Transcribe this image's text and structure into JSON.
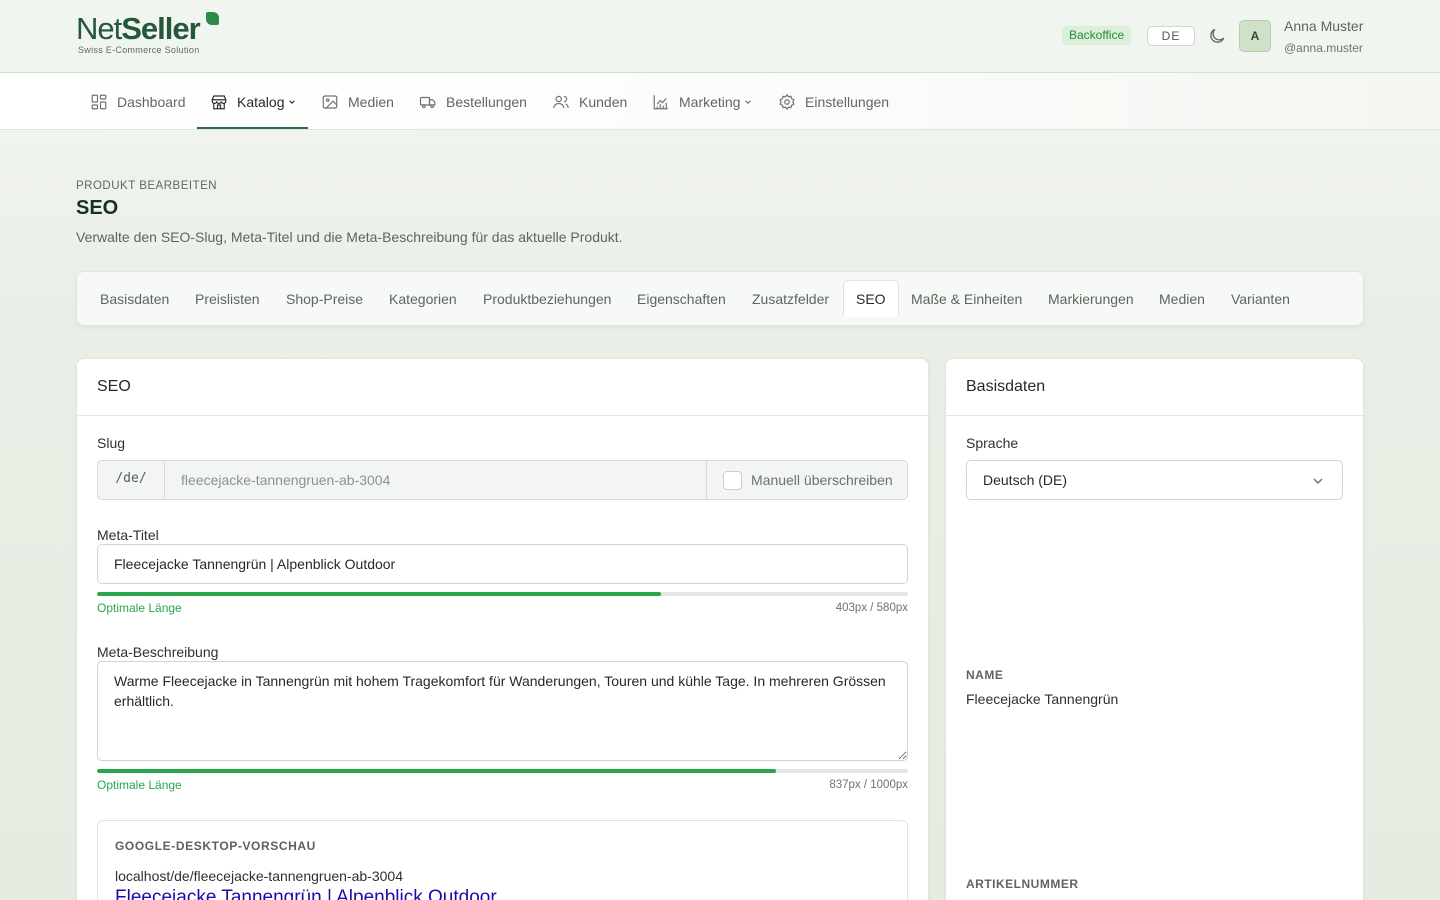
{
  "brand": {
    "logo_net": "Net",
    "logo_seller": "Seller",
    "tagline": "Swiss E-Commerce Solution"
  },
  "header": {
    "badge": "Backoffice",
    "language": "DE",
    "avatar_initial": "A",
    "user_name": "Anna Muster",
    "user_handle": "@anna.muster",
    "theme_icon": "moon-icon"
  },
  "nav": {
    "items": [
      {
        "label": "Dashboard",
        "icon": "dashboard-icon"
      },
      {
        "label": "Katalog",
        "icon": "store-icon",
        "active": true,
        "dropdown": true
      },
      {
        "label": "Medien",
        "icon": "image-icon"
      },
      {
        "label": "Bestellungen",
        "icon": "truck-icon"
      },
      {
        "label": "Kunden",
        "icon": "users-icon"
      },
      {
        "label": "Marketing",
        "icon": "chart-icon",
        "dropdown": true
      },
      {
        "label": "Einstellungen",
        "icon": "gear-icon"
      }
    ]
  },
  "page": {
    "eyebrow": "PRODUKT BEARBEITEN",
    "title": "SEO",
    "description": "Verwalte den SEO-Slug, Meta-Titel und die Meta-Beschreibung für das aktuelle Produkt."
  },
  "tabs": [
    {
      "label": "Basisdaten"
    },
    {
      "label": "Preislisten"
    },
    {
      "label": "Shop-Preise"
    },
    {
      "label": "Kategorien"
    },
    {
      "label": "Produktbeziehungen"
    },
    {
      "label": "Eigenschaften"
    },
    {
      "label": "Zusatzfelder"
    },
    {
      "label": "SEO",
      "active": true
    },
    {
      "label": "Maße & Einheiten"
    },
    {
      "label": "Markierungen"
    },
    {
      "label": "Medien"
    },
    {
      "label": "Varianten"
    }
  ],
  "seo": {
    "card_title": "SEO",
    "slug_label": "Slug",
    "slug_prefix": "/de/",
    "slug_value": "fleecejacke-tannengruen-ab-3004",
    "slug_override_label": "Manuell überschreiben",
    "meta_title_label": "Meta-Titel",
    "meta_title_value": "Fleecejacke Tannengrün | Alpenblick Outdoor",
    "meta_title_status": "Optimale Länge",
    "meta_title_length": "403px / 580px",
    "meta_title_ratio": 0.695,
    "meta_desc_label": "Meta-Beschreibung",
    "meta_desc_value": "Warme Fleecejacke in Tannengrün mit hohem Tragekomfort für Wanderungen, Touren und kühle Tage. In mehreren Grössen erhältlich.",
    "meta_desc_status": "Optimale Länge",
    "meta_desc_length": "837px / 1000px",
    "meta_desc_ratio": 0.837,
    "preview_label": "GOOGLE-DESKTOP-VORSCHAU",
    "preview_url": "localhost/de/fleecejacke-tannengruen-ab-3004",
    "preview_title": "Fleecejacke Tannengrün | Alpenblick Outdoor"
  },
  "basis": {
    "card_title": "Basisdaten",
    "language_label": "Sprache",
    "language_value": "Deutsch (DE)",
    "name_label": "NAME",
    "name_value": "Fleecejacke Tannengrün",
    "article_label": "ARTIKELNUMMER"
  },
  "colors": {
    "brand": "#25573a",
    "success": "#2aa64a",
    "link": "#1a0dab"
  }
}
